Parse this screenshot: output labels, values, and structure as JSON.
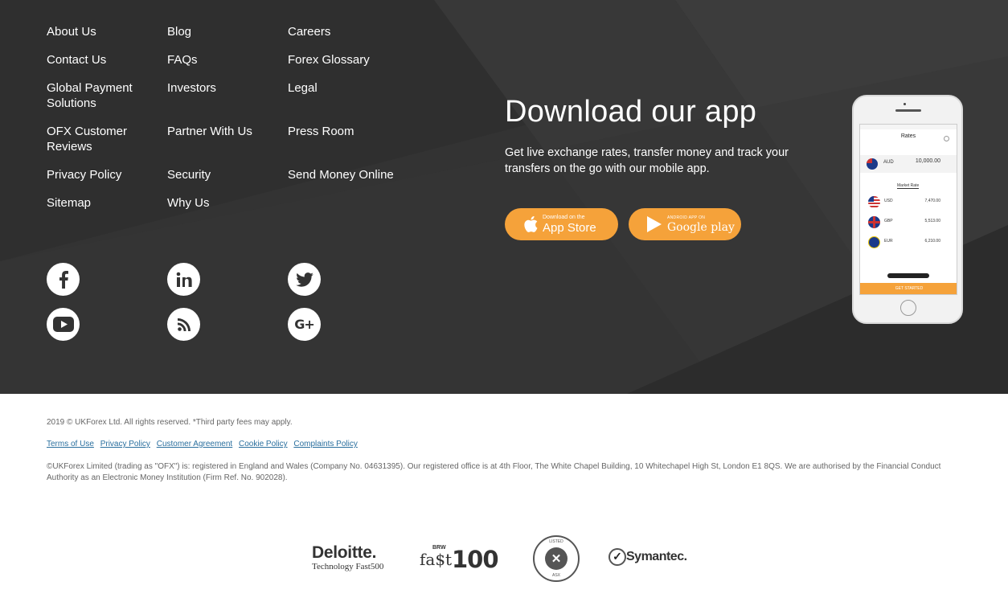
{
  "nav": {
    "col1": [
      "About Us",
      "Contact Us",
      "Global Payment Solutions",
      "OFX Customer Reviews",
      "Privacy Policy",
      "Sitemap"
    ],
    "col2": [
      "Blog",
      "FAQs",
      "Investors",
      "Partner With Us",
      "Security",
      "Why Us"
    ],
    "col3": [
      "Careers",
      "Forex Glossary",
      "Legal",
      "Press Room",
      "Send Money Online"
    ]
  },
  "social": [
    "facebook-icon",
    "linkedin-icon",
    "twitter-icon",
    "youtube-icon",
    "rss-icon",
    "google-plus-icon"
  ],
  "app": {
    "title": "Download our app",
    "description": "Get live exchange rates, transfer money and track your transfers on the go with our mobile app.",
    "appstore_small": "Download on the",
    "appstore_big": "App Store",
    "googleplay_small": "ANDROID APP ON",
    "googleplay_big": "Google play",
    "accent": "#f5a23a"
  },
  "phone": {
    "header": "Rates",
    "base_currency": "AUD",
    "base_amount": "10,000.00",
    "tab": "Market Rate",
    "rows": [
      {
        "cur": "USD",
        "amount": "7,470.00"
      },
      {
        "cur": "GBP",
        "amount": "5,513.00"
      },
      {
        "cur": "EUR",
        "amount": "6,210.00"
      }
    ],
    "cta": "GET STARTED"
  },
  "legal": {
    "copyright": "2019 © UKForex Ltd. All rights reserved.   *Third party fees may apply.",
    "links": [
      "Terms of Use",
      "Privacy Policy",
      "Customer Agreement",
      "Cookie Policy",
      "Complaints Policy"
    ],
    "notice": "©UKForex Limited (trading as \"OFX\") is: registered in England and Wales (Company No. 04631395). Our registered office is at 4th Floor, The White Chapel Building, 10 Whitechapel High St, London E1 8QS. We are authorised by the Financial Conduct Authority as an Electronic Money Institution (Firm Ref. No. 902028)."
  },
  "logos": {
    "deloitte": "Deloitte.",
    "deloitte_sub": "Technology Fast500",
    "brw": "BRW",
    "fast": "fa$t",
    "hundred": "100",
    "asx_top": "LISTED",
    "asx_bottom": "ASX",
    "symantec": "Symantec."
  }
}
